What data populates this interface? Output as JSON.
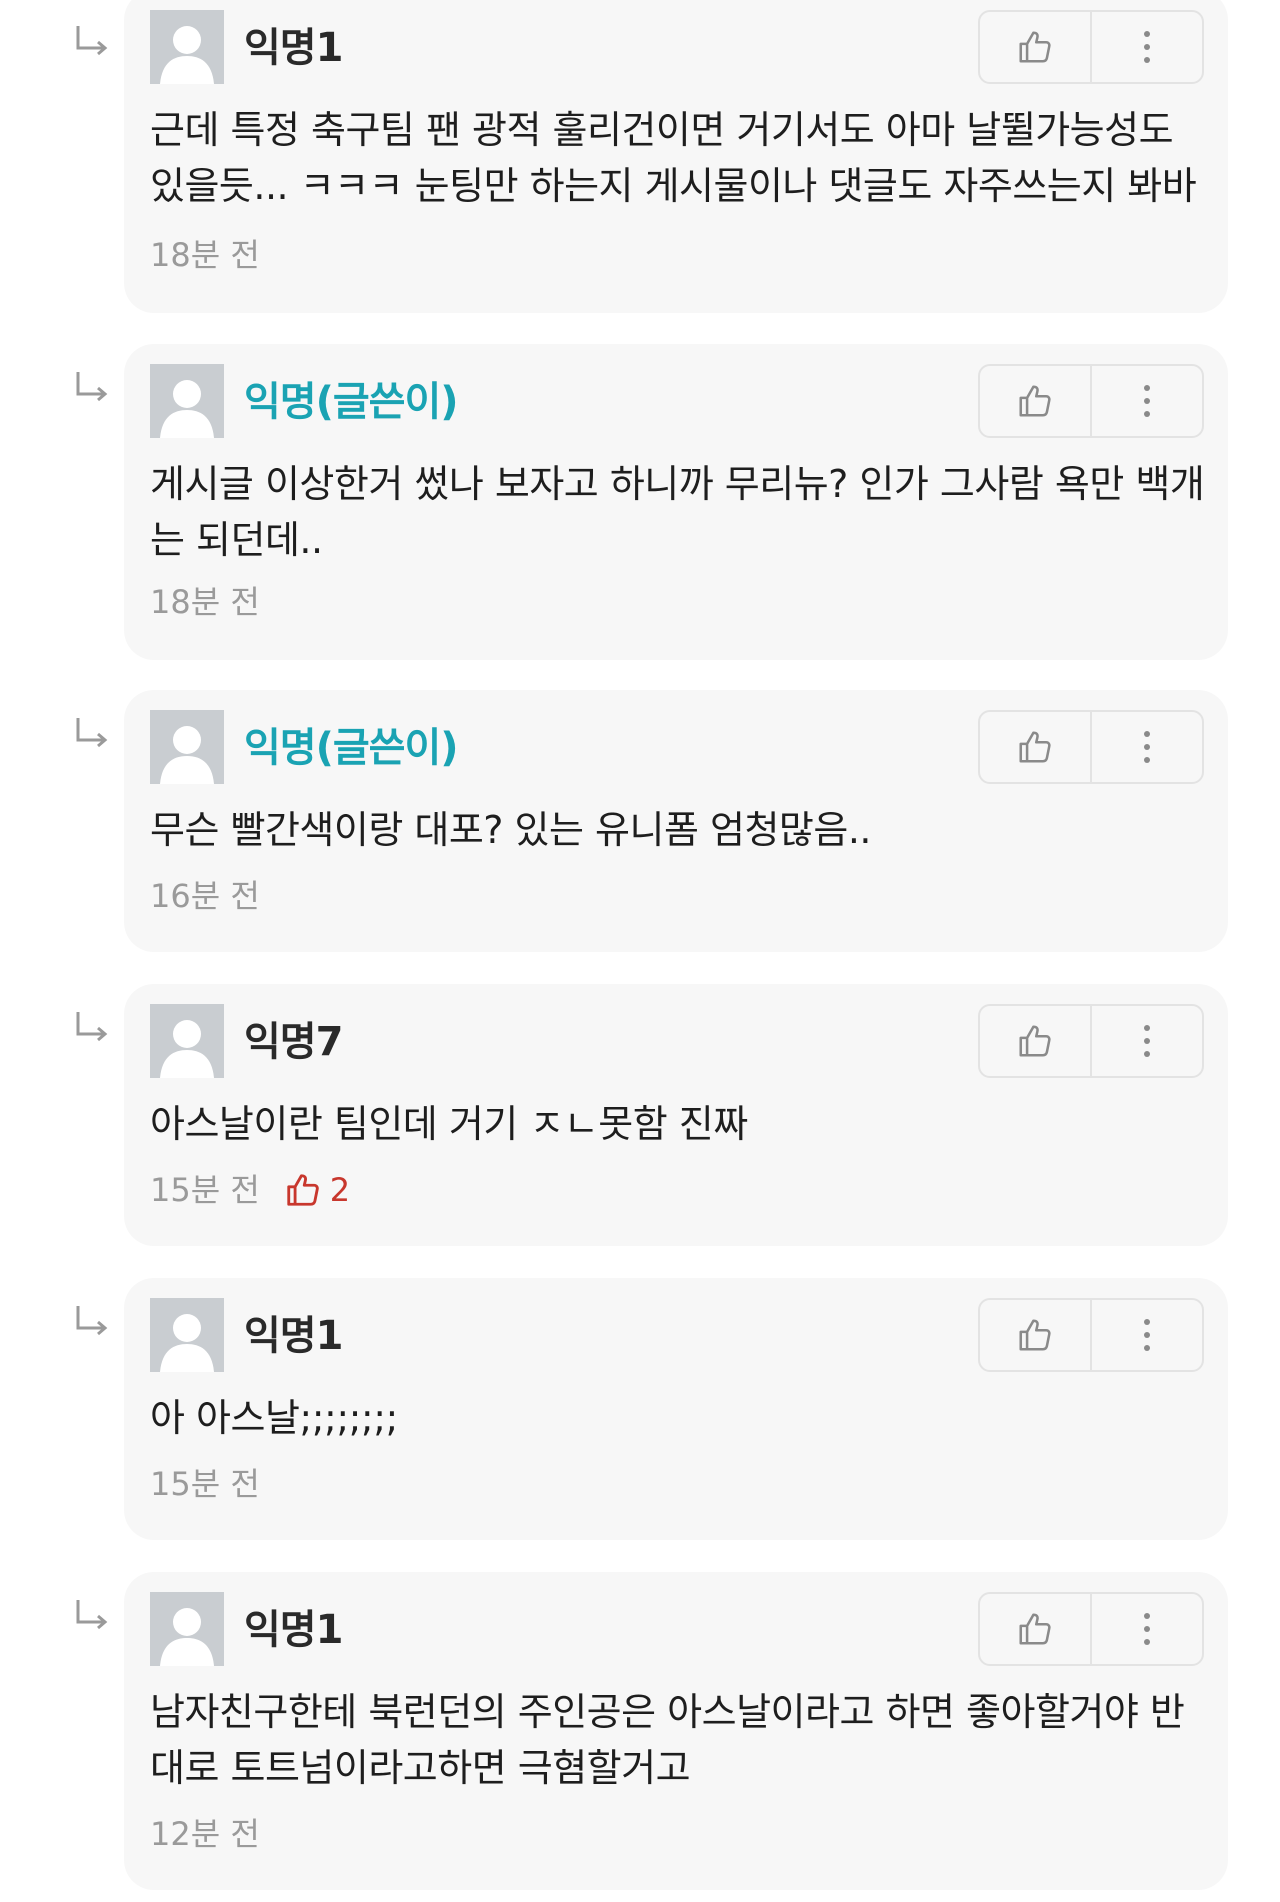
{
  "comments": [
    {
      "author": "익명1",
      "is_op": false,
      "body": "근데 특정 축구팀 팬 광적 훌리건이면 거기서도 아마 날뛸가능성도 있을듯... ㅋㅋㅋ 눈팅만 하는지 게시물이나 댓글도 자주쓰는지 봐바",
      "time": "18분 전",
      "likes": ""
    },
    {
      "author": "익명(글쓴이)",
      "is_op": true,
      "body": "게시글 이상한거 썼나 보자고 하니까 무리뉴? 인가 그사람 욕만 백개는 되던데..",
      "time": "18분 전",
      "likes": ""
    },
    {
      "author": "익명(글쓴이)",
      "is_op": true,
      "body": "무슨 빨간색이랑 대포? 있는 유니폼 엄청많음..",
      "time": "16분 전",
      "likes": ""
    },
    {
      "author": "익명7",
      "is_op": false,
      "body": "아스날이란 팀인데 거기 ㅈㄴ못함 진짜",
      "time": "15분 전",
      "likes": "2"
    },
    {
      "author": "익명1",
      "is_op": false,
      "body": "아 아스날;;;;;;;;",
      "time": "15분 전",
      "likes": ""
    },
    {
      "author": "익명1",
      "is_op": false,
      "body": "남자친구한테 북런던의 주인공은 아스날이라고 하면 좋아할거야 반대로 토트넘이라고하면 극혐할거고",
      "time": "12분 전",
      "likes": ""
    }
  ],
  "icons": {
    "reply": "reply-arrow-icon",
    "like": "thumbs-up-icon",
    "more": "more-vertical-icon",
    "avatar": "default-avatar-icon"
  },
  "colors": {
    "op_author": "#1aa3b3",
    "like_count": "#c8372d",
    "card_bg": "#f7f7f7"
  }
}
